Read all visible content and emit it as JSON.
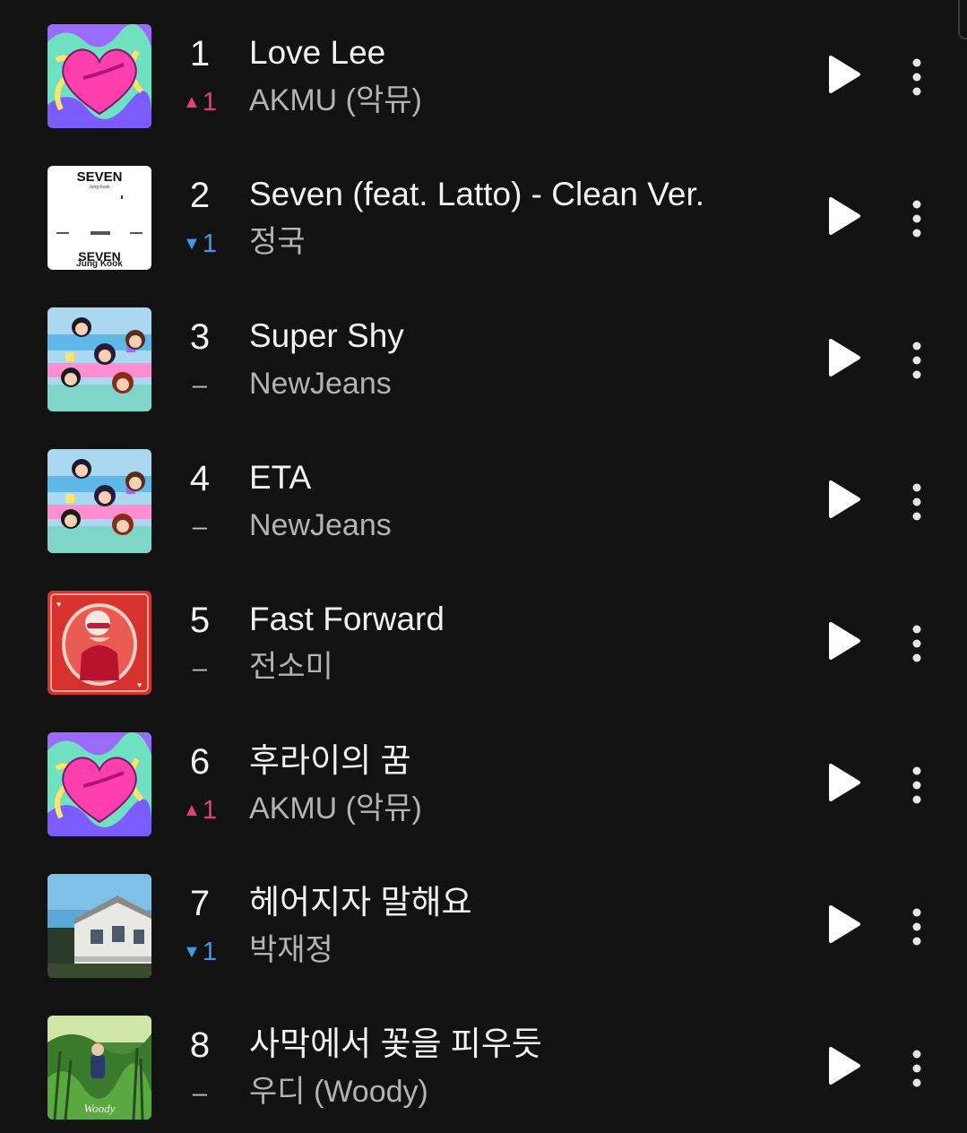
{
  "chart": [
    {
      "rank": "1",
      "change_symbol": "▲",
      "change_value": "1",
      "change_dir": "up",
      "title": "Love Lee",
      "artist": "AKMU (악뮤)",
      "art": "heart-art"
    },
    {
      "rank": "2",
      "change_symbol": "▼",
      "change_value": "1",
      "change_dir": "down",
      "title": "Seven (feat. Latto) - Clean Ver.",
      "artist": "정국",
      "art": "seven-art"
    },
    {
      "rank": "3",
      "change_symbol": "",
      "change_value": "–",
      "change_dir": "same",
      "title": "Super Shy",
      "artist": "NewJeans",
      "art": "newjeans-art"
    },
    {
      "rank": "4",
      "change_symbol": "",
      "change_value": "–",
      "change_dir": "same",
      "title": "ETA",
      "artist": "NewJeans",
      "art": "newjeans-art"
    },
    {
      "rank": "5",
      "change_symbol": "",
      "change_value": "–",
      "change_dir": "same",
      "title": "Fast Forward",
      "artist": "전소미",
      "art": "card-art"
    },
    {
      "rank": "6",
      "change_symbol": "▲",
      "change_value": "1",
      "change_dir": "up",
      "title": "후라이의 꿈",
      "artist": "AKMU (악뮤)",
      "art": "heart-art"
    },
    {
      "rank": "7",
      "change_symbol": "▼",
      "change_value": "1",
      "change_dir": "down",
      "title": "헤어지자 말해요",
      "artist": "박재정",
      "art": "house-art"
    },
    {
      "rank": "8",
      "change_symbol": "",
      "change_value": "–",
      "change_dir": "same",
      "title": "사막에서 꽃을 피우듯",
      "artist": "우디 (Woody)",
      "art": "forest-art"
    }
  ],
  "icons": {
    "play": "play-icon",
    "more": "more-vertical-icon"
  },
  "colors": {
    "background": "#121212",
    "rank_up": "#f03a78",
    "rank_down": "#3a9cf0",
    "title_text": "#f2f2f2",
    "artist_text": "#b3b3b3"
  },
  "art_text": {
    "seven_top": "SEVEN",
    "seven_sub": "Jung Kook",
    "seven_bottom": "SEVEN",
    "seven_bottom_sub": "Jung Kook",
    "woody_sign": "Woody"
  }
}
